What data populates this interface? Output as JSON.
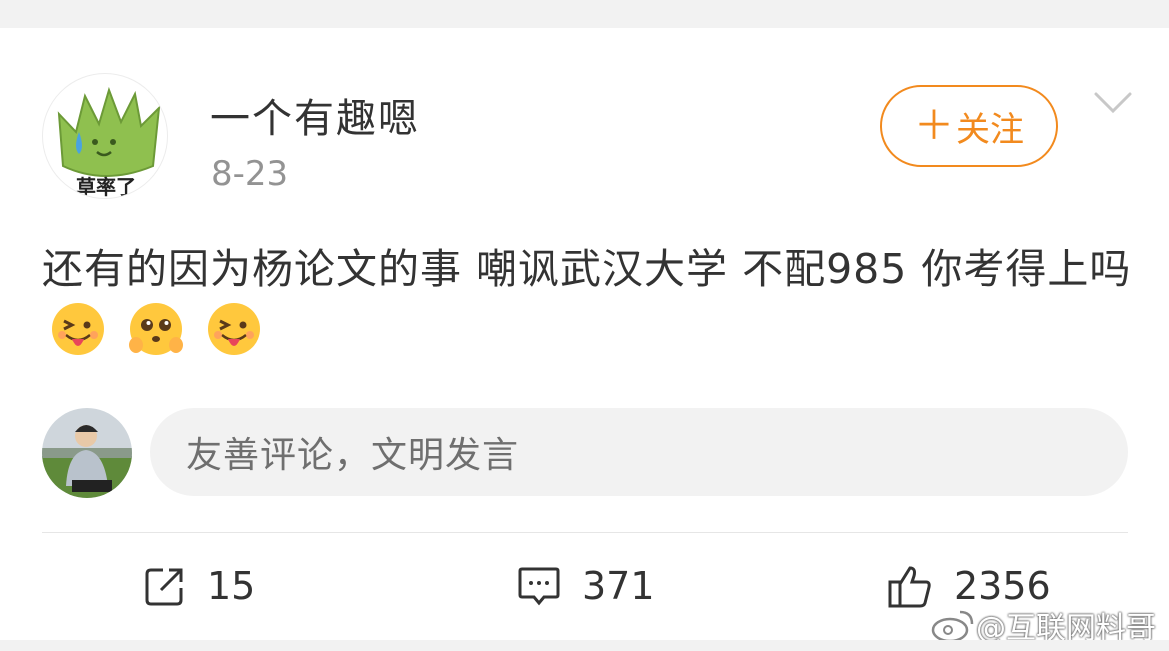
{
  "post": {
    "author": "一个有趣嗯",
    "date": "8-23",
    "avatar_badge_text": "草率了",
    "follow_label": "关注",
    "text": "还有的因为杨论文的事 嘲讽武汉大学 不配985 你考得上吗",
    "emojis": [
      "tongue-out-emoji",
      "pleading-emoji",
      "tongue-out-emoji"
    ]
  },
  "comment": {
    "placeholder": "友善评论，文明发言"
  },
  "actions": {
    "share_count": "15",
    "comment_count": "371",
    "like_count": "2356"
  },
  "watermark": {
    "text": "@互联网料哥"
  },
  "colors": {
    "accent": "#f28a1e",
    "text": "#333333",
    "muted": "#939393",
    "input_bg": "#f2f2f2"
  }
}
